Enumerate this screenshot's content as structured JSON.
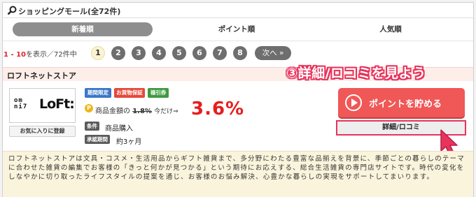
{
  "header": {
    "title": "ショッピングモール(全72件)",
    "icon": "search-icon"
  },
  "tabs": [
    {
      "label": "新着順",
      "active": true
    },
    {
      "label": "ポイント順",
      "active": false
    },
    {
      "label": "人気順",
      "active": false
    }
  ],
  "pager": {
    "range": "1 - 10",
    "suffix": "を表示／72件中",
    "pages": [
      "1",
      "2",
      "3",
      "4",
      "5",
      "6",
      "7",
      "8"
    ],
    "current": "1",
    "next": "次へ »"
  },
  "annotation": "③詳細/ロコミを見よう",
  "store": {
    "name": "ロフトネットストア",
    "logo_text": "omni loft",
    "fav_button": "お気に入りに登録",
    "tags": [
      "期間限定",
      "お買物保証",
      "福引券"
    ],
    "coin": "P",
    "price_label": "商品金額の",
    "old_rate": "1.8%",
    "now_label": "今だけ⇒",
    "rate": "3.6%",
    "cond_label": "条件",
    "cond_value": "商品購入",
    "approve_label": "承認期間",
    "approve_value": "約3ヶ月",
    "point_button": "ポイントを貯める",
    "detail_button": "詳細/ロコミ",
    "description": "ロフトネットストアは文具・コスメ・生活用品からギフト雑貨まで、多分野にわたる豊富な品揃えを背景に、季節ごとの暮らしのテーマに合わせた雑貨の編集でお客様の「きっと何かが見つかる」という期待にお応えする、総合生活雑貨の専門店サイトです。時代の変化をしなやかに切り取ったライフスタイルの提案を通じ、お客様のお悩み解決、心豊かな暮らしの実現をサポートしてまいります。"
  },
  "colors": {
    "accent": "#e61e1e",
    "button_red": "#f05757",
    "annotation": "#e8335d"
  }
}
